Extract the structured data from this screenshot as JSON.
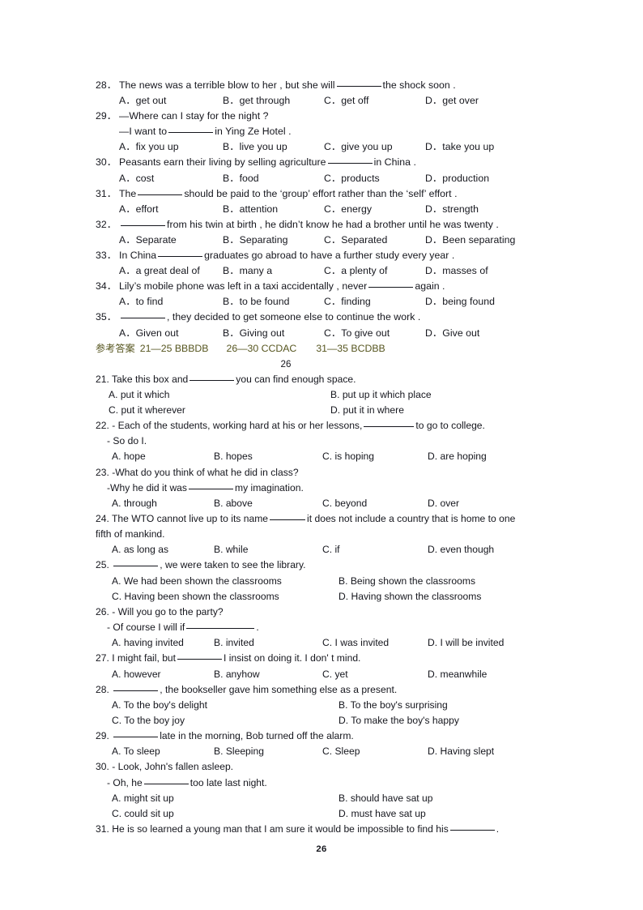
{
  "document": {
    "page_number_footer": "26",
    "page_marker_mid": "26",
    "body_color": "#15161d",
    "answer_key_color": "#56551f"
  },
  "section1": {
    "questions": [
      {
        "num": "28．",
        "stem_a": "The news was a terrible blow to her , but she will",
        "stem_b": "the shock soon .",
        "options": [
          "A．get out",
          "B．get through",
          "C．get off",
          "D．get over"
        ]
      },
      {
        "num": "29．",
        "stem_a": "—Where can I stay for the night ?",
        "stem_b": "",
        "sub_a": "—I want to",
        "sub_b": "in Ying Ze Hotel .",
        "options": [
          "A．fix you up",
          "B．live you up",
          "C．give you up",
          "D．take you up"
        ]
      },
      {
        "num": "30．",
        "stem_a": "Peasants earn their living by selling agriculture",
        "stem_b": "in China .",
        "options": [
          "A．cost",
          "B．food",
          "C．products",
          "D．production"
        ]
      },
      {
        "num": "31．",
        "stem_a": "The",
        "stem_b": "should be paid to the ‘group’ effort rather than the ‘self’ effort .",
        "options": [
          "A．effort",
          "B．attention",
          "C．energy",
          "D．strength"
        ]
      },
      {
        "num": "32．",
        "stem_a": "",
        "stem_b": "from his twin at birth , he didn’t know he had a brother until he was twenty .",
        "options": [
          "A．Separate",
          "B．Separating",
          "C．Separated",
          "D．Been separating"
        ]
      },
      {
        "num": "33．",
        "stem_a": "In China",
        "stem_b": "graduates go abroad to have a further study every year .",
        "options": [
          "A．a great deal of",
          "B．many a",
          "C．a plenty of",
          "D．masses of"
        ]
      },
      {
        "num": "34．",
        "stem_a": "Lily’s mobile phone was left in a taxi accidentally , never",
        "stem_b": "again .",
        "options": [
          "A．to find",
          "B．to be found",
          "C．finding",
          "D．being found"
        ]
      },
      {
        "num": "35．",
        "stem_a": "",
        "stem_b": ", they decided to get someone else to continue the work .",
        "options": [
          "A．Given out",
          "B．Giving out",
          "C．To give out",
          "D．Give out"
        ]
      }
    ]
  },
  "answer_key": {
    "label": "参考答案",
    "groups": [
      "21—25 BBBDB",
      "26—30 CCDAC",
      "31—35 BCDBB"
    ]
  },
  "section2": {
    "questions": [
      {
        "num": "21.",
        "stem_a": "Take this box and",
        "stem_b": "you can find enough space.",
        "layout": "two-col",
        "options": [
          "A. put it which",
          "B. put up it which place",
          "C. put it wherever",
          "D. put it in where"
        ]
      },
      {
        "num": "22.",
        "stem_a": "- Each of the students, working hard at his or her lessons,",
        "stem_b": "to go to college.",
        "sub_plain": "- So do I.",
        "layout": "four-col",
        "options": [
          "A. hope",
          "B. hopes",
          "C. is hoping",
          "D. are hoping"
        ]
      },
      {
        "num": "23.",
        "stem_plain": "-What do you think of what he did in class?",
        "sub_a": "-Why he did it was",
        "sub_b": "my imagination.",
        "layout": "four-col",
        "options": [
          "A. through",
          "B. above",
          "C. beyond",
          "D. over"
        ]
      },
      {
        "num": "24.",
        "stem_a": "The WTO cannot live up to its name",
        "stem_b": "it does not include a country that is home to one",
        "stem_wrap": "fifth of mankind.",
        "layout": "four-col",
        "options": [
          "A. as long as",
          "B. while",
          "C. if",
          "D. even though"
        ]
      },
      {
        "num": "25.",
        "stem_a": "",
        "stem_b": ", we were taken to see the library.",
        "layout": "two-col",
        "options": [
          "A. We had been shown the classrooms",
          "B. Being shown the classrooms",
          "C. Having been shown the classrooms",
          "D. Having shown the classrooms"
        ]
      },
      {
        "num": "26.",
        "stem_plain": "- Will you go to the party?",
        "sub_a": "- Of course I will if",
        "sub_b": ".",
        "layout": "four-col",
        "options": [
          "A. having invited",
          "B. invited",
          "C. I was invited",
          "D. I will be invited"
        ]
      },
      {
        "num": "27.",
        "stem_a": "I might fail, but",
        "stem_b": "I insist on doing it. I don' t mind.",
        "layout": "four-col",
        "options": [
          "A. however",
          "B. anyhow",
          "C. yet",
          "D. meanwhile"
        ]
      },
      {
        "num": "28.",
        "stem_a": "",
        "stem_b": ", the bookseller gave him something else as a present.",
        "layout": "two-col",
        "options": [
          "A. To the boy's delight",
          "B. To the boy's surprising",
          "C. To the boy joy",
          "D. To make the boy's happy"
        ]
      },
      {
        "num": "29.",
        "stem_a": "",
        "stem_b": "late in the morning, Bob turned off the alarm.",
        "layout": "four-col",
        "options": [
          "A. To sleep",
          "B. Sleeping",
          "C. Sleep",
          "D. Having slept"
        ]
      },
      {
        "num": "30.",
        "stem_plain": "- Look, John's fallen asleep.",
        "sub_a": "- Oh, he",
        "sub_b": "too late last night.",
        "layout": "two-col",
        "options": [
          "A. might sit up",
          "B. should have sat up",
          "C. could sit up",
          "D. must have sat up"
        ]
      },
      {
        "num": "31.",
        "stem_a": "He is so learned a young man that I am sure it would be impossible to find his",
        "stem_b": ".",
        "layout": "none",
        "options": []
      }
    ]
  }
}
